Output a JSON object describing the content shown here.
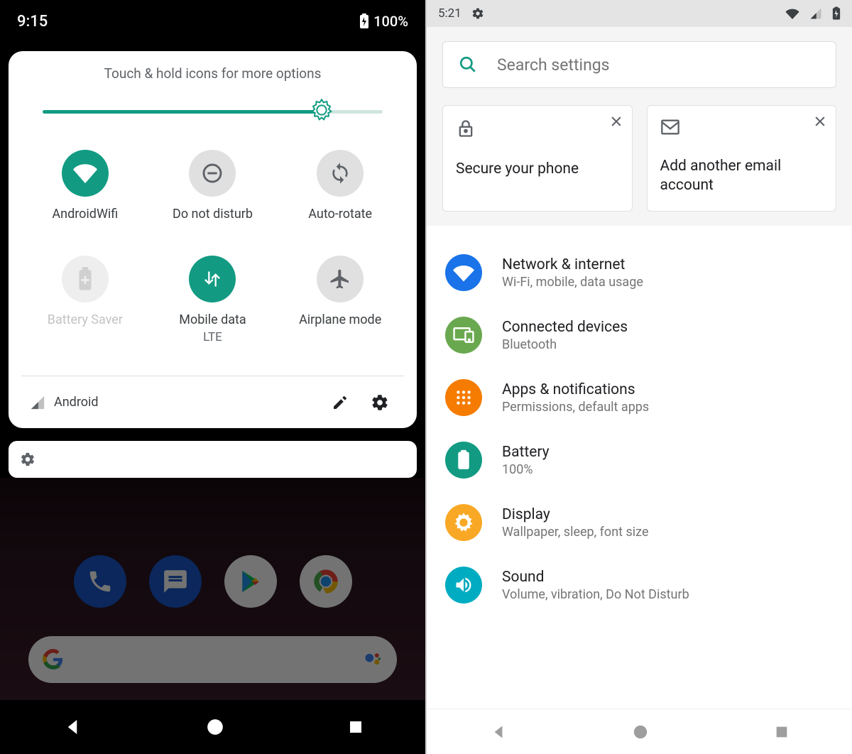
{
  "left": {
    "status": {
      "time": "9:15",
      "battery": "100%"
    },
    "qs": {
      "hint": "Touch & hold icons for more options",
      "brightness_pct": 82,
      "tiles": [
        {
          "label": "AndroidWifi",
          "icon": "wifi",
          "state": "active"
        },
        {
          "label": "Do not disturb",
          "icon": "dnd",
          "state": "inactive"
        },
        {
          "label": "Auto-rotate",
          "icon": "rotate",
          "state": "inactive"
        },
        {
          "label": "Battery Saver",
          "icon": "battery-saver",
          "state": "disabled"
        },
        {
          "label": "Mobile data",
          "sublabel": "LTE",
          "icon": "data",
          "state": "active"
        },
        {
          "label": "Airplane mode",
          "icon": "airplane",
          "state": "inactive"
        }
      ],
      "footer_carrier": "Android"
    }
  },
  "right": {
    "status": {
      "time": "5:21"
    },
    "search_placeholder": "Search settings",
    "cards": [
      {
        "title": "Secure your phone",
        "icon": "lock"
      },
      {
        "title": "Add another email account",
        "icon": "mail"
      }
    ],
    "items": [
      {
        "title": "Network & internet",
        "sub": "Wi-Fi, mobile, data usage",
        "color": "#1a73e8",
        "icon": "wifi"
      },
      {
        "title": "Connected devices",
        "sub": "Bluetooth",
        "color": "#6aa84f",
        "icon": "devices"
      },
      {
        "title": "Apps & notifications",
        "sub": "Permissions, default apps",
        "color": "#f57c00",
        "icon": "apps"
      },
      {
        "title": "Battery",
        "sub": "100%",
        "color": "#129b82",
        "icon": "battery"
      },
      {
        "title": "Display",
        "sub": "Wallpaper, sleep, font size",
        "color": "#f9a825",
        "icon": "brightness"
      },
      {
        "title": "Sound",
        "sub": "Volume, vibration, Do Not Disturb",
        "color": "#00acc1",
        "icon": "sound"
      }
    ]
  }
}
